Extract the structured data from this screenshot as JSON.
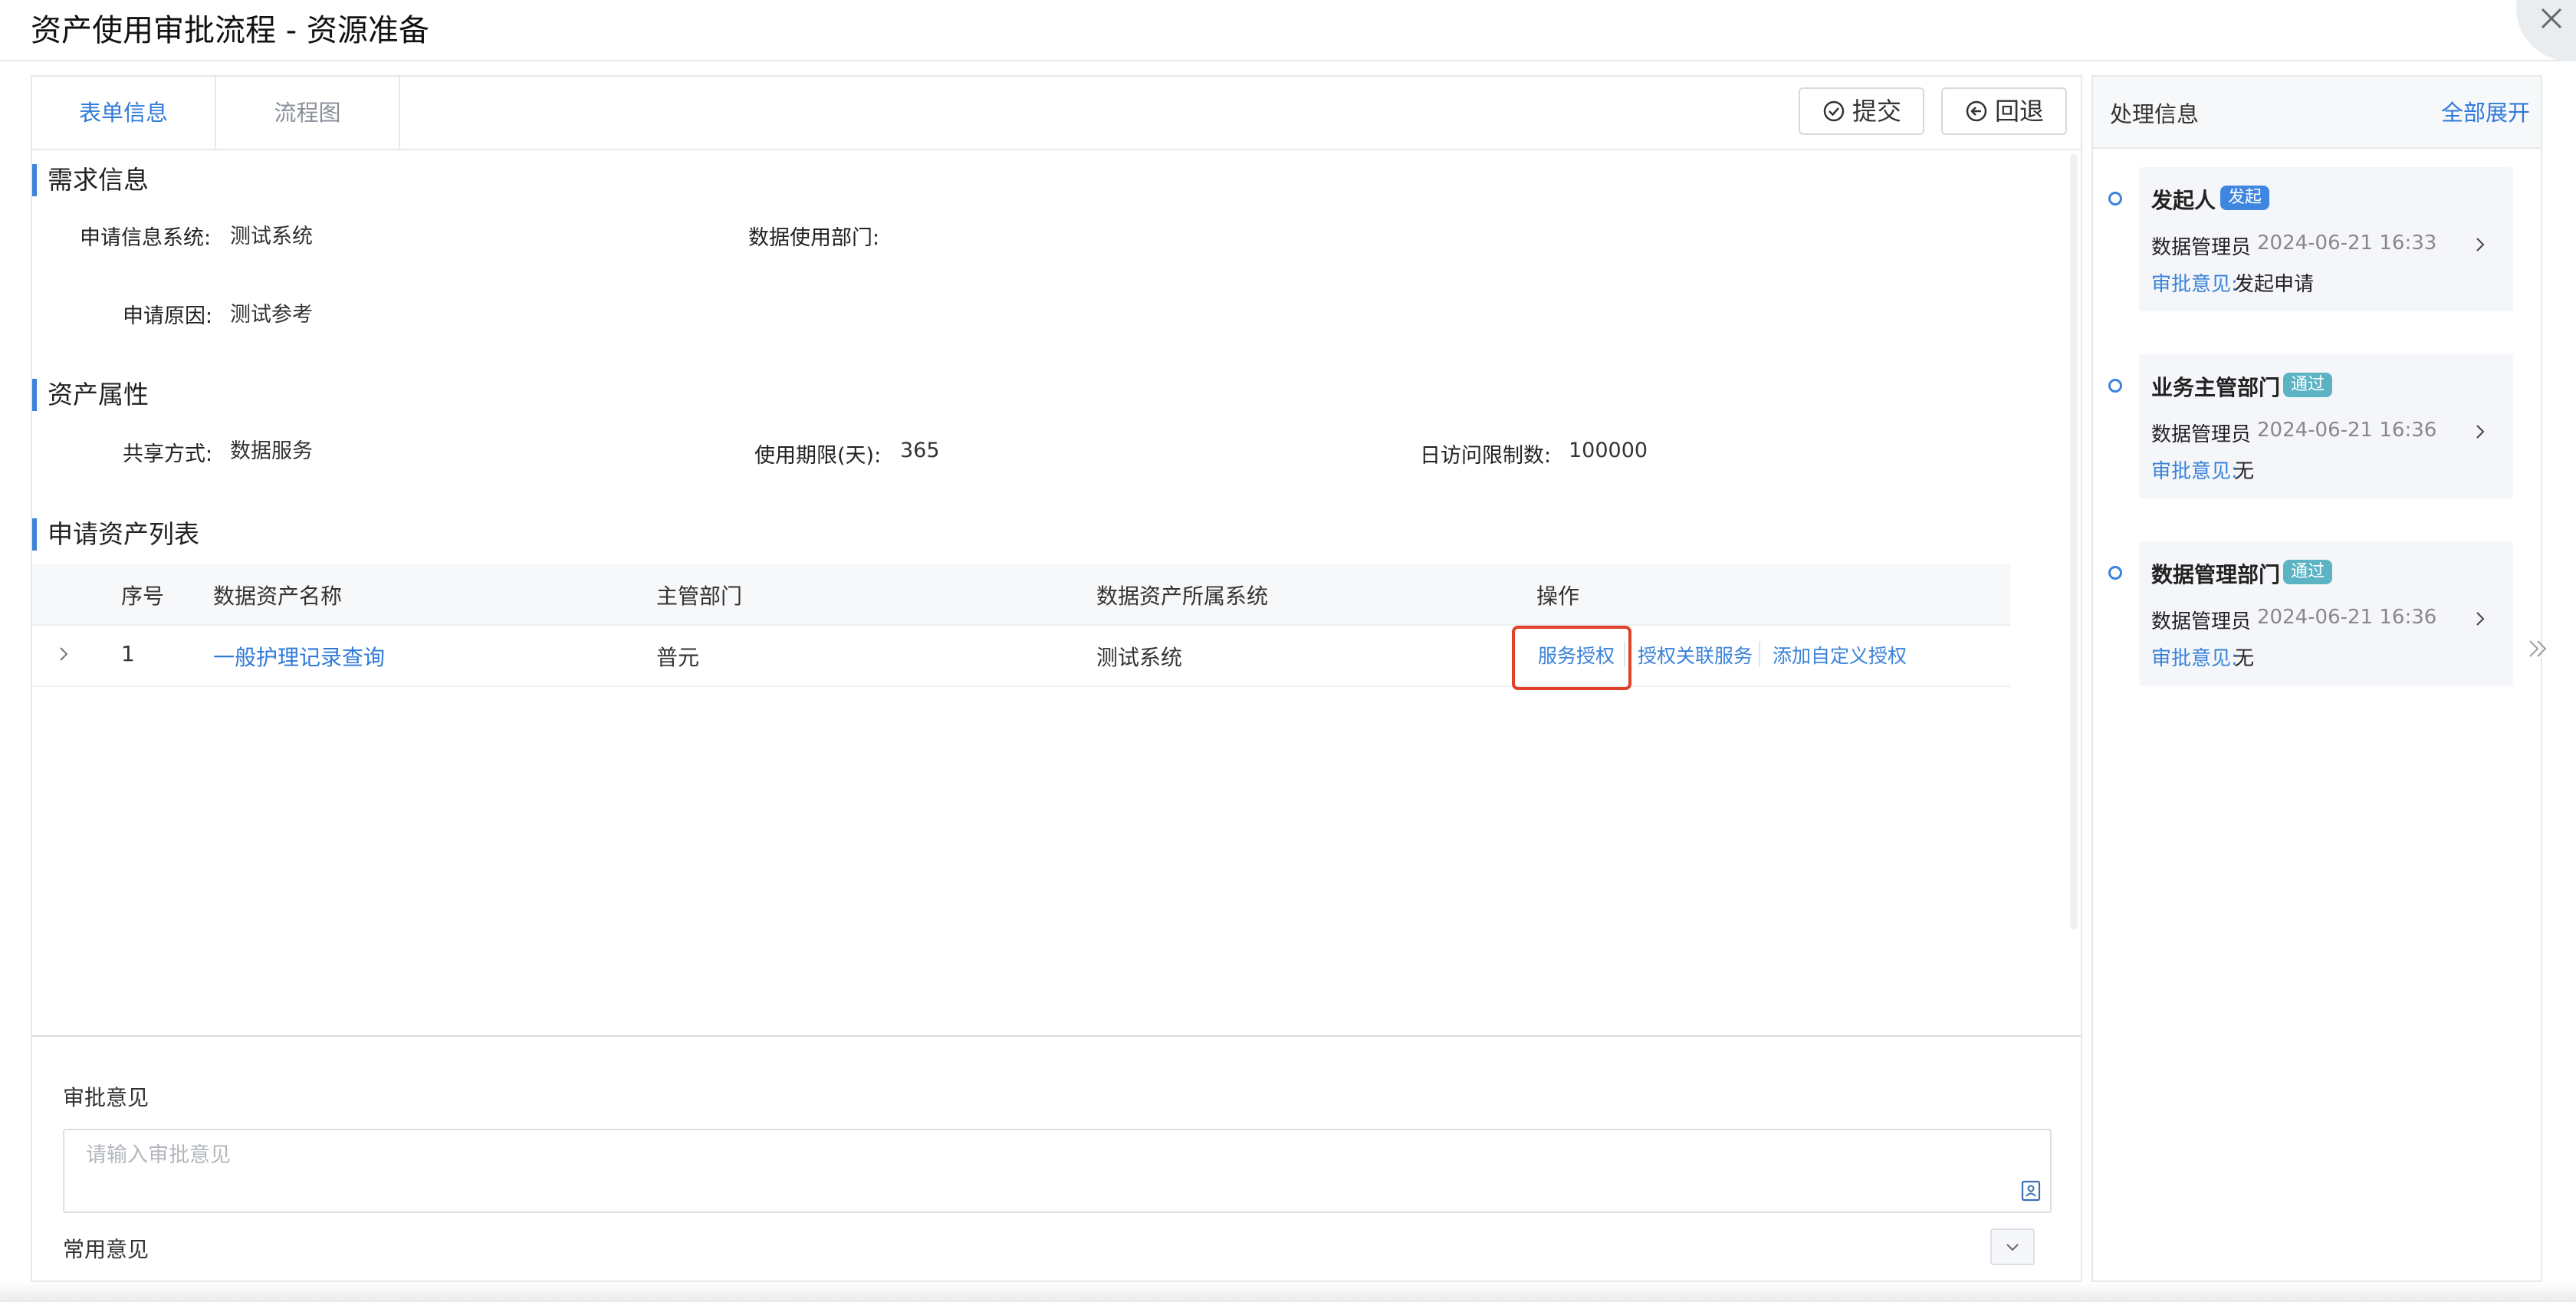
{
  "dialog": {
    "title": "资产使用审批流程 - 资源准备"
  },
  "tabs": [
    {
      "label": "表单信息",
      "active": true
    },
    {
      "label": "流程图",
      "active": false
    }
  ],
  "toolbar": {
    "submit_label": "提交",
    "rollback_label": "回退"
  },
  "sections": {
    "requirement": {
      "title": "需求信息",
      "fields": [
        {
          "label": "申请信息系统:",
          "value": "测试系统"
        },
        {
          "label": "数据使用部门:",
          "value": ""
        },
        {
          "label": "申请原因:",
          "value": "测试参考"
        }
      ]
    },
    "asset_attributes": {
      "title": "资产属性",
      "fields": [
        {
          "label": "共享方式:",
          "value": "数据服务"
        },
        {
          "label": "使用期限(天):",
          "value": "365"
        },
        {
          "label": "日访问限制数:",
          "value": "100000"
        }
      ]
    },
    "asset_list": {
      "title": "申请资产列表",
      "columns": [
        "序号",
        "数据资产名称",
        "主管部门",
        "数据资产所属系统",
        "操作"
      ],
      "rows": [
        {
          "index": "1",
          "name": "一般护理记录查询",
          "dept": "普元",
          "system": "测试系统",
          "actions": [
            "服务授权",
            "授权关联服务",
            "添加自定义授权"
          ]
        }
      ]
    }
  },
  "approval": {
    "label": "审批意见",
    "placeholder": "请输入审批意见",
    "value": "",
    "common_label": "常用意见"
  },
  "side_panel": {
    "title": "处理信息",
    "expand_all": "全部展开",
    "timeline": [
      {
        "node": "发起人",
        "badge": "发起",
        "badge_color": "#3f86e0",
        "user": "数据管理员",
        "time": "2024-06-21 16:33",
        "comment_label": "审批意见:",
        "comment": "发起申请"
      },
      {
        "node": "业务主管部门",
        "badge": "通过",
        "badge_color": "#5bb3c4",
        "user": "数据管理员",
        "time": "2024-06-21 16:36",
        "comment_label": "审批意见:",
        "comment": "无"
      },
      {
        "node": "数据管理部门",
        "badge": "通过",
        "badge_color": "#5bb3c4",
        "user": "数据管理员",
        "time": "2024-06-21 16:36",
        "comment_label": "审批意见:",
        "comment": "无"
      }
    ]
  },
  "colors": {
    "accent": "#2f7ad8",
    "section_bar": "#3b83db",
    "highlight": "#e0402c"
  },
  "icons": [
    "close-icon",
    "check-circle-icon",
    "back-circle-icon",
    "expand-row-icon",
    "bookmark-icon",
    "chevron-down-icon",
    "chevron-right-icon",
    "double-chevron-right-icon"
  ]
}
